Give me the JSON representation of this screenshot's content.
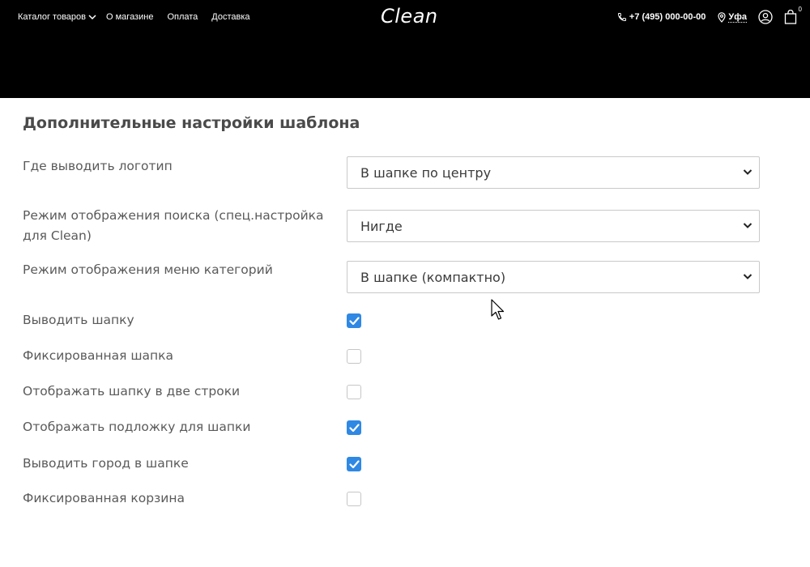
{
  "header": {
    "nav": [
      {
        "label": "Каталог товаров",
        "icon": "chevron-down-icon"
      },
      {
        "label": "О магазине"
      },
      {
        "label": "Оплата"
      },
      {
        "label": "Доставка"
      }
    ],
    "logo_text": "Clean",
    "phone": "+7 (495) 000-00-00",
    "city": "Уфа",
    "cart_count": "0",
    "icons": [
      "phone-icon",
      "location-pin-icon",
      "user-icon",
      "cart-icon"
    ],
    "background_color": "#000000"
  },
  "settings": {
    "title": "Дополнительные настройки шаблона",
    "selects": [
      {
        "label": "Где выводить логотип",
        "value": "В шапке по центру"
      },
      {
        "label": "Режим отображения поиска (спец.настройка для Clean)",
        "value": "Нигде"
      },
      {
        "label": "Режим отображения меню категорий",
        "value": "В шапке (компактно)"
      }
    ],
    "checkboxes": [
      {
        "label": "Выводить шапку",
        "checked": true
      },
      {
        "label": "Фиксированная шапка",
        "checked": false
      },
      {
        "label": "Отображать шапку в две строки",
        "checked": false
      },
      {
        "label": "Отображать подложку для шапки",
        "checked": true
      },
      {
        "label": "Выводить город в шапке",
        "checked": true
      },
      {
        "label": "Фиксированная корзина",
        "checked": false
      }
    ],
    "accent_color": "#2f88e3"
  }
}
